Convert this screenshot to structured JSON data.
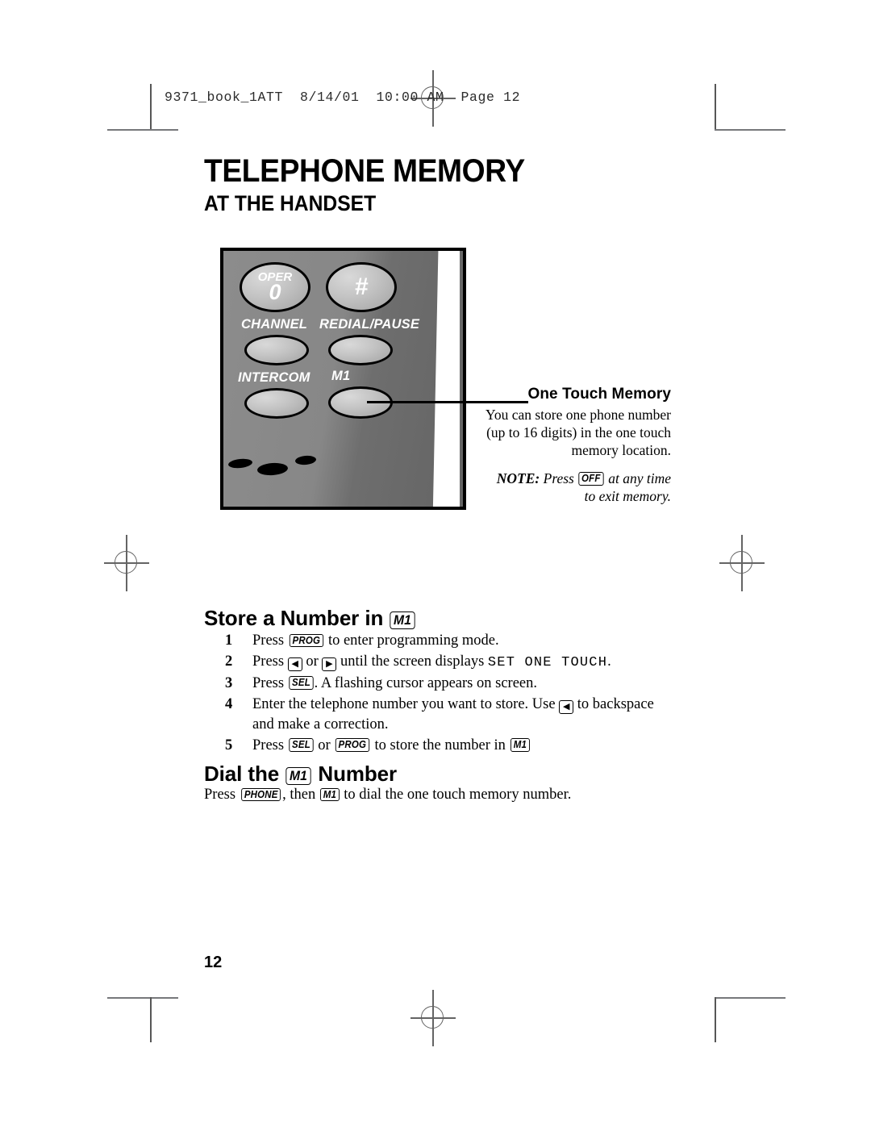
{
  "file_header": "9371_book_1ATT  8/14/01  10:00 AM  Page 12",
  "title": {
    "main": "TELEPHONE MEMORY",
    "sub": "AT THE HANDSET"
  },
  "phone": {
    "buttons": [
      {
        "name": "oper-zero-key",
        "top_label": "OPER",
        "main_label": "0"
      },
      {
        "name": "pound-key",
        "top_label": "",
        "main_label": "#"
      }
    ],
    "captions": [
      "CHANNEL",
      "REDIAL/PAUSE",
      "INTERCOM",
      "M1"
    ]
  },
  "callout": {
    "title": "One Touch Memory",
    "body": "You can store one phone number (up to 16 digits) in the one touch memory location.",
    "note_prefix": "NOTE:",
    "note_mid": "Press",
    "note_key": "OFF",
    "note_suffix": "at any time to exit memory."
  },
  "store_section": {
    "heading_pre": "Store a Number in",
    "heading_key": "M1",
    "steps": [
      {
        "num": "1",
        "parts": [
          {
            "t": "text",
            "v": "Press "
          },
          {
            "t": "key",
            "v": "PROG"
          },
          {
            "t": "text",
            "v": " to enter programming mode."
          }
        ]
      },
      {
        "num": "2",
        "parts": [
          {
            "t": "text",
            "v": "Press "
          },
          {
            "t": "arrow",
            "v": "◀"
          },
          {
            "t": "text",
            "v": " or "
          },
          {
            "t": "arrow",
            "v": "▶"
          },
          {
            "t": "text",
            "v": " until the screen displays "
          },
          {
            "t": "lcd",
            "v": "SET ONE TOUCH"
          },
          {
            "t": "text",
            "v": "."
          }
        ]
      },
      {
        "num": "3",
        "parts": [
          {
            "t": "text",
            "v": "Press "
          },
          {
            "t": "key",
            "v": "SEL"
          },
          {
            "t": "text",
            "v": ". A flashing cursor appears on screen."
          }
        ]
      },
      {
        "num": "4",
        "parts": [
          {
            "t": "text",
            "v": "Enter the telephone number you want to store.  Use "
          },
          {
            "t": "arrow",
            "v": "◀"
          },
          {
            "t": "text",
            "v": " to backspace and make a correction."
          }
        ]
      },
      {
        "num": "5",
        "parts": [
          {
            "t": "text",
            "v": "Press "
          },
          {
            "t": "key",
            "v": "SEL"
          },
          {
            "t": "text",
            "v": " or "
          },
          {
            "t": "key",
            "v": "PROG"
          },
          {
            "t": "text",
            "v": " to store the number in "
          },
          {
            "t": "key",
            "v": "M1"
          }
        ]
      }
    ]
  },
  "dial_section": {
    "heading_pre": "Dial the",
    "heading_key": "M1",
    "heading_post": "Number",
    "body_parts": [
      {
        "t": "text",
        "v": "Press "
      },
      {
        "t": "key",
        "v": "PHONE"
      },
      {
        "t": "text",
        "v": ", then "
      },
      {
        "t": "key",
        "v": "M1"
      },
      {
        "t": "text",
        "v": " to dial the one touch memory number."
      }
    ]
  },
  "page_number": "12",
  "colors": {
    "ink": "#000000",
    "crop_mark": "#646464",
    "phone_body": "#808080"
  }
}
